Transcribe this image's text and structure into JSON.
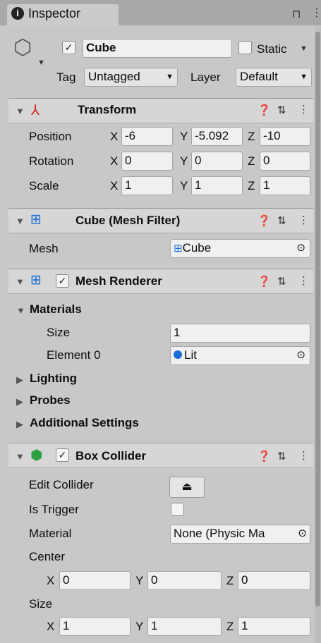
{
  "tab": {
    "title": "Inspector"
  },
  "object": {
    "name": "Cube",
    "static_label": "Static",
    "tag_label": "Tag",
    "tag_value": "Untagged",
    "layer_label": "Layer",
    "layer_value": "Default"
  },
  "transform": {
    "title": "Transform",
    "rows": [
      {
        "label": "Position",
        "x": "-6",
        "y": "-5.092",
        "z": "-10"
      },
      {
        "label": "Rotation",
        "x": "0",
        "y": "0",
        "z": "0"
      },
      {
        "label": "Scale",
        "x": "1",
        "y": "1",
        "z": "1"
      }
    ]
  },
  "mesh_filter": {
    "title": "Cube (Mesh Filter)",
    "mesh_label": "Mesh",
    "mesh_value": "Cube"
  },
  "mesh_renderer": {
    "title": "Mesh Renderer",
    "materials_label": "Materials",
    "size_label": "Size",
    "size_value": "1",
    "element_label": "Element 0",
    "element_value": "Lit",
    "lighting": "Lighting",
    "probes": "Probes",
    "additional": "Additional Settings"
  },
  "box_collider": {
    "title": "Box Collider",
    "edit_collider": "Edit Collider",
    "is_trigger": "Is Trigger",
    "material_label": "Material",
    "material_value": "None (Physic Ma",
    "center_label": "Center",
    "center": {
      "x": "0",
      "y": "0",
      "z": "0"
    },
    "size_label": "Size",
    "size": {
      "x": "1",
      "y": "1",
      "z": "1"
    }
  },
  "axes": {
    "x": "X",
    "y": "Y",
    "z": "Z"
  }
}
